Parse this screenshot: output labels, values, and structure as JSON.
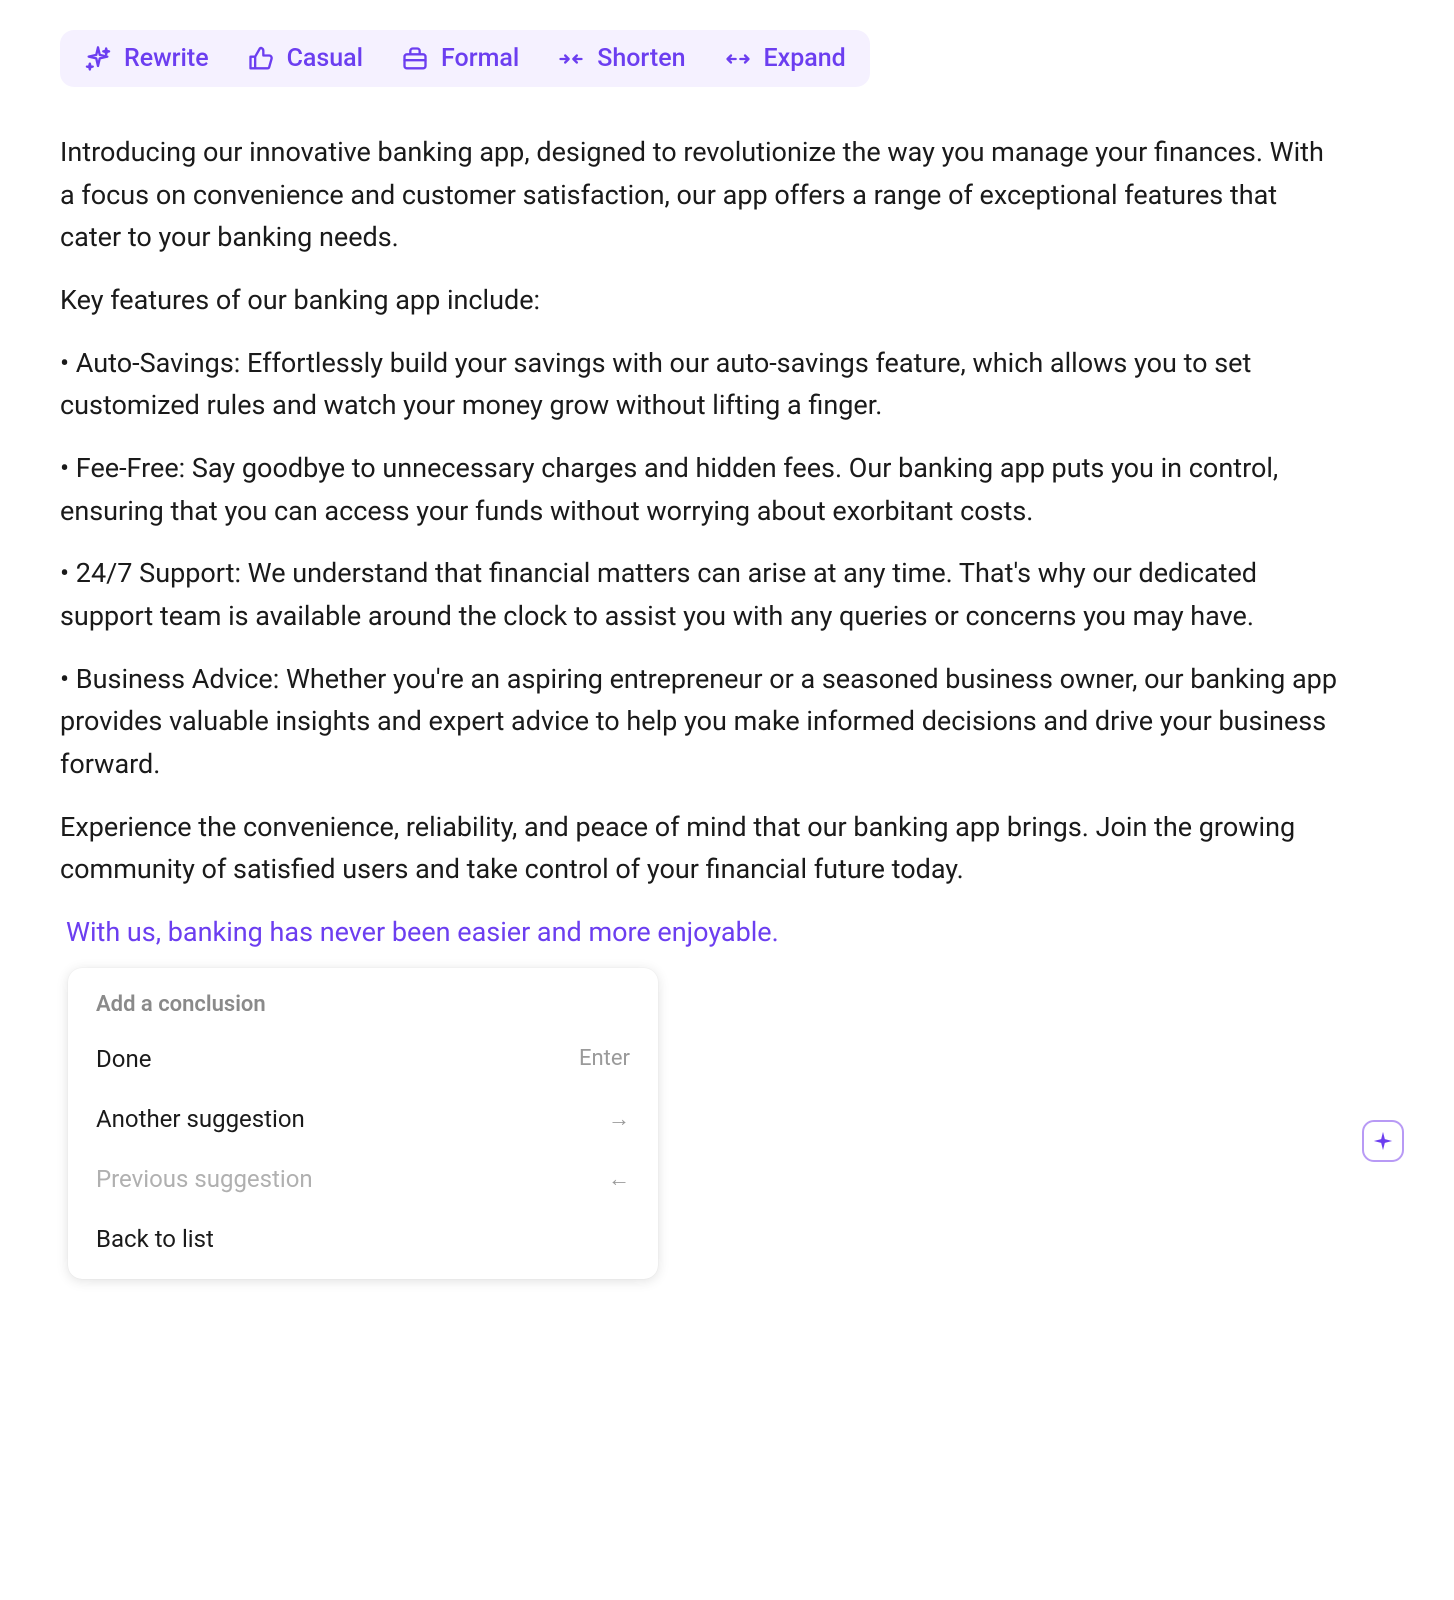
{
  "toolbar": {
    "rewrite_label": "Rewrite",
    "casual_label": "Casual",
    "formal_label": "Formal",
    "shorten_label": "Shorten",
    "expand_label": "Expand"
  },
  "content": {
    "p1": "Introducing our innovative banking app, designed to revolutionize the way you manage your finances. With a focus on convenience and customer satisfaction, our app offers a range of exceptional features that cater to your banking needs.",
    "p2": "Key features of our banking app include:",
    "p3": "• Auto-Savings: Effortlessly build your savings with our auto-savings feature, which allows you to set customized rules and watch your money grow without lifting a finger.",
    "p4": "• Fee-Free: Say goodbye to unnecessary charges and hidden fees. Our banking app puts you in control, ensuring that you can access your funds without worrying about exorbitant costs.",
    "p5": "• 24/7 Support: We understand that financial matters can arise at any time. That's why our dedicated support team is available around the clock to assist you with any queries or concerns you may have.",
    "p6": "• Business Advice: Whether you're an aspiring entrepreneur or a seasoned business owner, our banking app provides valuable insights and expert advice to help you make informed decisions and drive your business forward.",
    "p7": "Experience the convenience, reliability, and peace of mind that our banking app brings. Join the growing community of satisfied users and take control of your financial future today.",
    "highlight": "With us, banking has never been easier and more enjoyable."
  },
  "popup": {
    "title": "Add a conclusion",
    "done_label": "Done",
    "done_shortcut": "Enter",
    "another_label": "Another suggestion",
    "another_shortcut": "→",
    "previous_label": "Previous suggestion",
    "previous_shortcut": "←",
    "back_label": "Back to list"
  }
}
